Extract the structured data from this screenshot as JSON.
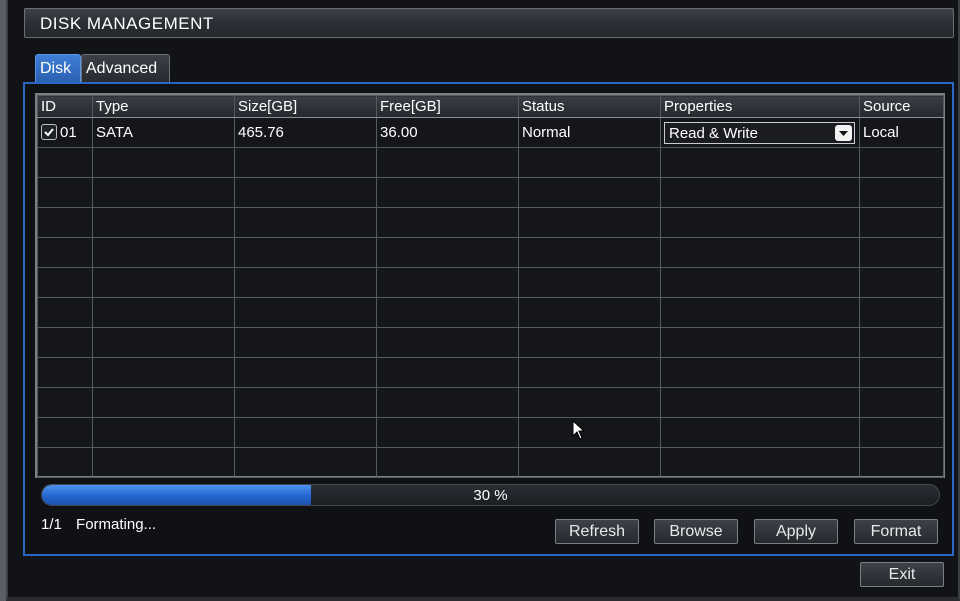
{
  "window": {
    "title": "DISK MANAGEMENT"
  },
  "tabs": [
    {
      "label": "Disk",
      "active": true
    },
    {
      "label": "Advanced",
      "active": false
    }
  ],
  "table": {
    "columns": [
      "ID",
      "Type",
      "Size[GB]",
      "Free[GB]",
      "Status",
      "Properties",
      "Source"
    ],
    "rows": [
      {
        "checked": true,
        "id": "01",
        "type": "SATA",
        "size": "465.76",
        "free": "36.00",
        "status": "Normal",
        "properties": "Read & Write",
        "source": "Local"
      }
    ],
    "empty_rows": 11
  },
  "progress": {
    "percent": 30,
    "label": "30 %"
  },
  "status": {
    "count": "1/1",
    "message": "Formating..."
  },
  "buttons": {
    "refresh": "Refresh",
    "browse": "Browse",
    "apply": "Apply",
    "format": "Format",
    "exit": "Exit"
  },
  "colors": {
    "accent": "#2c67c8",
    "progress_fill": "#2466cf",
    "background": "#111317"
  }
}
